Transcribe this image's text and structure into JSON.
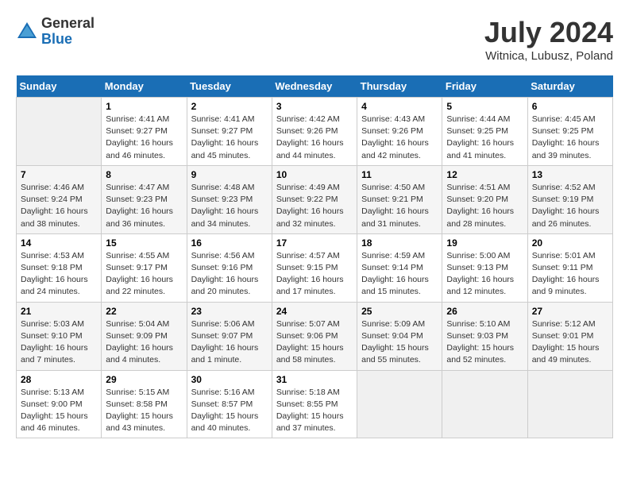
{
  "header": {
    "logo_general": "General",
    "logo_blue": "Blue",
    "month_year": "July 2024",
    "location": "Witnica, Lubusz, Poland"
  },
  "calendar": {
    "days_of_week": [
      "Sunday",
      "Monday",
      "Tuesday",
      "Wednesday",
      "Thursday",
      "Friday",
      "Saturday"
    ],
    "weeks": [
      [
        {
          "day": "",
          "info": ""
        },
        {
          "day": "1",
          "info": "Sunrise: 4:41 AM\nSunset: 9:27 PM\nDaylight: 16 hours\nand 46 minutes."
        },
        {
          "day": "2",
          "info": "Sunrise: 4:41 AM\nSunset: 9:27 PM\nDaylight: 16 hours\nand 45 minutes."
        },
        {
          "day": "3",
          "info": "Sunrise: 4:42 AM\nSunset: 9:26 PM\nDaylight: 16 hours\nand 44 minutes."
        },
        {
          "day": "4",
          "info": "Sunrise: 4:43 AM\nSunset: 9:26 PM\nDaylight: 16 hours\nand 42 minutes."
        },
        {
          "day": "5",
          "info": "Sunrise: 4:44 AM\nSunset: 9:25 PM\nDaylight: 16 hours\nand 41 minutes."
        },
        {
          "day": "6",
          "info": "Sunrise: 4:45 AM\nSunset: 9:25 PM\nDaylight: 16 hours\nand 39 minutes."
        }
      ],
      [
        {
          "day": "7",
          "info": "Sunrise: 4:46 AM\nSunset: 9:24 PM\nDaylight: 16 hours\nand 38 minutes."
        },
        {
          "day": "8",
          "info": "Sunrise: 4:47 AM\nSunset: 9:23 PM\nDaylight: 16 hours\nand 36 minutes."
        },
        {
          "day": "9",
          "info": "Sunrise: 4:48 AM\nSunset: 9:23 PM\nDaylight: 16 hours\nand 34 minutes."
        },
        {
          "day": "10",
          "info": "Sunrise: 4:49 AM\nSunset: 9:22 PM\nDaylight: 16 hours\nand 32 minutes."
        },
        {
          "day": "11",
          "info": "Sunrise: 4:50 AM\nSunset: 9:21 PM\nDaylight: 16 hours\nand 31 minutes."
        },
        {
          "day": "12",
          "info": "Sunrise: 4:51 AM\nSunset: 9:20 PM\nDaylight: 16 hours\nand 28 minutes."
        },
        {
          "day": "13",
          "info": "Sunrise: 4:52 AM\nSunset: 9:19 PM\nDaylight: 16 hours\nand 26 minutes."
        }
      ],
      [
        {
          "day": "14",
          "info": "Sunrise: 4:53 AM\nSunset: 9:18 PM\nDaylight: 16 hours\nand 24 minutes."
        },
        {
          "day": "15",
          "info": "Sunrise: 4:55 AM\nSunset: 9:17 PM\nDaylight: 16 hours\nand 22 minutes."
        },
        {
          "day": "16",
          "info": "Sunrise: 4:56 AM\nSunset: 9:16 PM\nDaylight: 16 hours\nand 20 minutes."
        },
        {
          "day": "17",
          "info": "Sunrise: 4:57 AM\nSunset: 9:15 PM\nDaylight: 16 hours\nand 17 minutes."
        },
        {
          "day": "18",
          "info": "Sunrise: 4:59 AM\nSunset: 9:14 PM\nDaylight: 16 hours\nand 15 minutes."
        },
        {
          "day": "19",
          "info": "Sunrise: 5:00 AM\nSunset: 9:13 PM\nDaylight: 16 hours\nand 12 minutes."
        },
        {
          "day": "20",
          "info": "Sunrise: 5:01 AM\nSunset: 9:11 PM\nDaylight: 16 hours\nand 9 minutes."
        }
      ],
      [
        {
          "day": "21",
          "info": "Sunrise: 5:03 AM\nSunset: 9:10 PM\nDaylight: 16 hours\nand 7 minutes."
        },
        {
          "day": "22",
          "info": "Sunrise: 5:04 AM\nSunset: 9:09 PM\nDaylight: 16 hours\nand 4 minutes."
        },
        {
          "day": "23",
          "info": "Sunrise: 5:06 AM\nSunset: 9:07 PM\nDaylight: 16 hours\nand 1 minute."
        },
        {
          "day": "24",
          "info": "Sunrise: 5:07 AM\nSunset: 9:06 PM\nDaylight: 15 hours\nand 58 minutes."
        },
        {
          "day": "25",
          "info": "Sunrise: 5:09 AM\nSunset: 9:04 PM\nDaylight: 15 hours\nand 55 minutes."
        },
        {
          "day": "26",
          "info": "Sunrise: 5:10 AM\nSunset: 9:03 PM\nDaylight: 15 hours\nand 52 minutes."
        },
        {
          "day": "27",
          "info": "Sunrise: 5:12 AM\nSunset: 9:01 PM\nDaylight: 15 hours\nand 49 minutes."
        }
      ],
      [
        {
          "day": "28",
          "info": "Sunrise: 5:13 AM\nSunset: 9:00 PM\nDaylight: 15 hours\nand 46 minutes."
        },
        {
          "day": "29",
          "info": "Sunrise: 5:15 AM\nSunset: 8:58 PM\nDaylight: 15 hours\nand 43 minutes."
        },
        {
          "day": "30",
          "info": "Sunrise: 5:16 AM\nSunset: 8:57 PM\nDaylight: 15 hours\nand 40 minutes."
        },
        {
          "day": "31",
          "info": "Sunrise: 5:18 AM\nSunset: 8:55 PM\nDaylight: 15 hours\nand 37 minutes."
        },
        {
          "day": "",
          "info": ""
        },
        {
          "day": "",
          "info": ""
        },
        {
          "day": "",
          "info": ""
        }
      ]
    ]
  }
}
